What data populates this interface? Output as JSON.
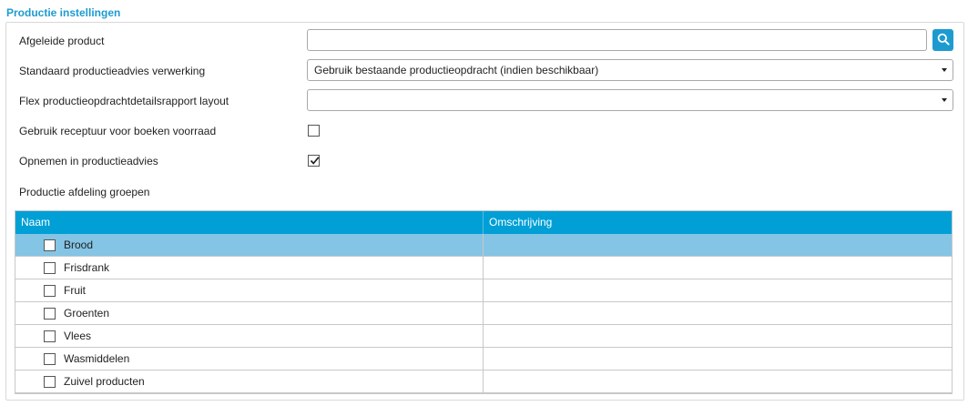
{
  "section": {
    "title": "Productie instellingen"
  },
  "fields": {
    "derived_product": {
      "label": "Afgeleide product",
      "value": ""
    },
    "standard_advice": {
      "label": "Standaard productieadvies verwerking",
      "selected": "Gebruik bestaande productieopdracht (indien beschikbaar)"
    },
    "flex_layout": {
      "label": "Flex productieopdrachtdetailsrapport layout",
      "selected": ""
    },
    "use_recipe": {
      "label": "Gebruik receptuur voor boeken voorraad",
      "checked": false
    },
    "include_advice": {
      "label": "Opnemen in productieadvies",
      "checked": true
    },
    "groups_label": "Productie afdeling groepen"
  },
  "grid": {
    "columns": [
      "Naam",
      "Omschrijving"
    ],
    "rows": [
      {
        "name": "Brood",
        "description": "",
        "checked": false,
        "selected": true
      },
      {
        "name": "Frisdrank",
        "description": "",
        "checked": false,
        "selected": false
      },
      {
        "name": "Fruit",
        "description": "",
        "checked": false,
        "selected": false
      },
      {
        "name": "Groenten",
        "description": "",
        "checked": false,
        "selected": false
      },
      {
        "name": "Vlees",
        "description": "",
        "checked": false,
        "selected": false
      },
      {
        "name": "Wasmiddelen",
        "description": "",
        "checked": false,
        "selected": false
      },
      {
        "name": "Zuivel producten",
        "description": "",
        "checked": false,
        "selected": false
      }
    ]
  },
  "icons": {
    "search": "search-icon",
    "dropdown": "chevron-down-icon",
    "check": "checkmark-icon"
  },
  "colors": {
    "accent": "#009fd6",
    "selected_row": "#84c4e5",
    "title": "#1d9bd1"
  }
}
